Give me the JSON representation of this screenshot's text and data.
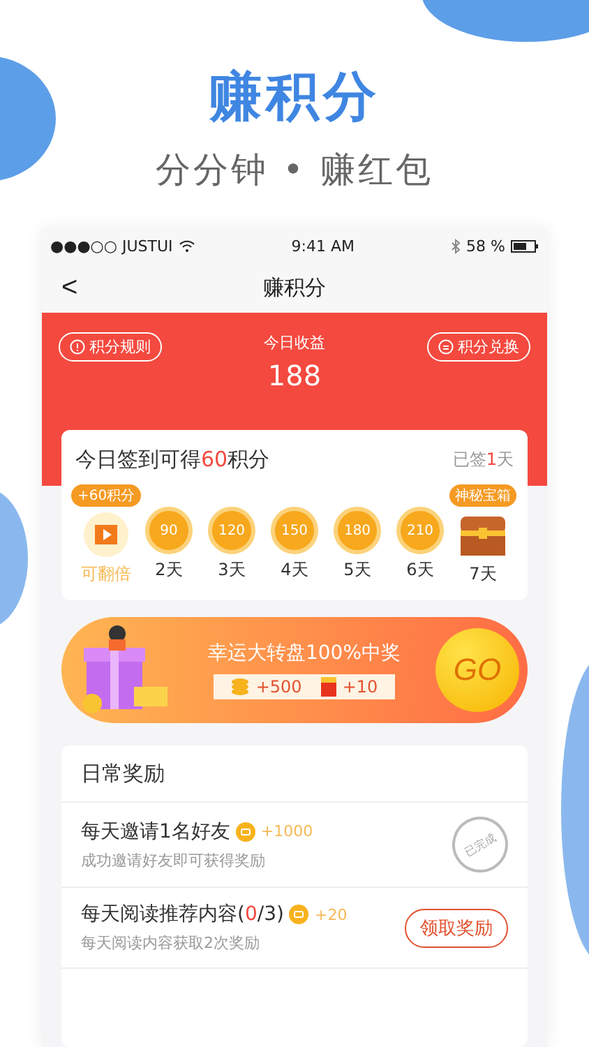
{
  "promo": {
    "title": "赚积分",
    "subtitle": "分分钟 • 赚红包"
  },
  "status_bar": {
    "carrier": "●●●○○ JUSTUI",
    "time": "9:41 AM",
    "battery": "58 %"
  },
  "nav": {
    "back": "<",
    "title": "赚积分"
  },
  "header": {
    "rules": "积分规则",
    "exchange": "积分兑换",
    "label": "今日收益",
    "value": "188"
  },
  "sign_in": {
    "title_start": "今日签到可得",
    "title_points": "60",
    "title_end": "积分",
    "status_start": "已签",
    "status_days": "1",
    "status_end": "天",
    "days": [
      {
        "kind": "video",
        "badge": "+60积分",
        "label": "可翻倍"
      },
      {
        "kind": "coin",
        "amount": "90",
        "label": "2天"
      },
      {
        "kind": "coin",
        "amount": "120",
        "label": "3天"
      },
      {
        "kind": "coin",
        "amount": "150",
        "label": "4天"
      },
      {
        "kind": "coin",
        "amount": "180",
        "label": "5天"
      },
      {
        "kind": "coin",
        "amount": "210",
        "label": "6天"
      },
      {
        "kind": "chest",
        "badge": "神秘宝箱",
        "label": "7天"
      }
    ]
  },
  "banner": {
    "title": "幸运大转盘100%中奖",
    "coins": "+500",
    "red_packets": "+10",
    "go": "GO"
  },
  "daily": {
    "title": "日常奖励",
    "tasks": [
      {
        "title_start": "每天邀请1名好友",
        "reward": "+1000",
        "desc": "成功邀请好友即可获得奖励",
        "kind": "stamp",
        "action_text": "已完成"
      },
      {
        "title_start": "每天阅读推荐内容(",
        "progress": "0",
        "title_end": "/3)",
        "reward": "+20",
        "desc": "每天阅读内容获取2次奖励",
        "kind": "button",
        "action_text": "领取奖励"
      }
    ]
  }
}
